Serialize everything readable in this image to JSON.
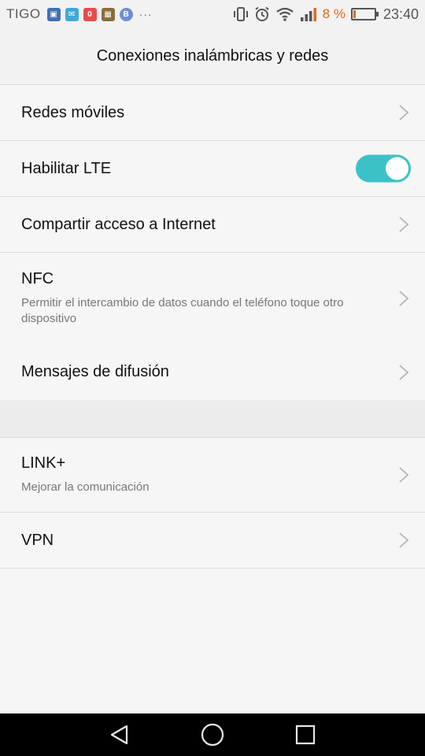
{
  "status_bar": {
    "carrier": "TIGO",
    "notification_icons": [
      {
        "name": "notif-app-icon-1",
        "color": "#3f6fb5",
        "glyph": "▣"
      },
      {
        "name": "notif-app-icon-2",
        "color": "#3fa8d8",
        "glyph": "✉"
      },
      {
        "name": "notif-app-icon-3",
        "color": "#e84b4b",
        "glyph": "0"
      },
      {
        "name": "notif-photo-icon",
        "color": "#8a6d3b",
        "glyph": "▦"
      },
      {
        "name": "notif-bluetooth-icon",
        "color": "#6f8fd0",
        "glyph": "B"
      }
    ],
    "more_indicator": "···",
    "battery_percent": "8 %",
    "battery_level": 0.08,
    "time": "23:40"
  },
  "header": {
    "title": "Conexiones inalámbricas y redes"
  },
  "items": [
    {
      "title": "Redes móviles"
    },
    {
      "title": "Habilitar LTE",
      "toggle_on": true
    },
    {
      "title": "Compartir acceso a Internet"
    },
    {
      "title": "NFC",
      "subtitle": "Permitir el intercambio de datos cuando el teléfono toque otro dispositivo"
    },
    {
      "title": "Mensajes de difusión"
    },
    {
      "title": "LINK+",
      "subtitle": "Mejorar la comunicación"
    },
    {
      "title": "VPN"
    }
  ],
  "colors": {
    "accent": "#3cc2c6",
    "battery_low": "#e06a1a"
  }
}
